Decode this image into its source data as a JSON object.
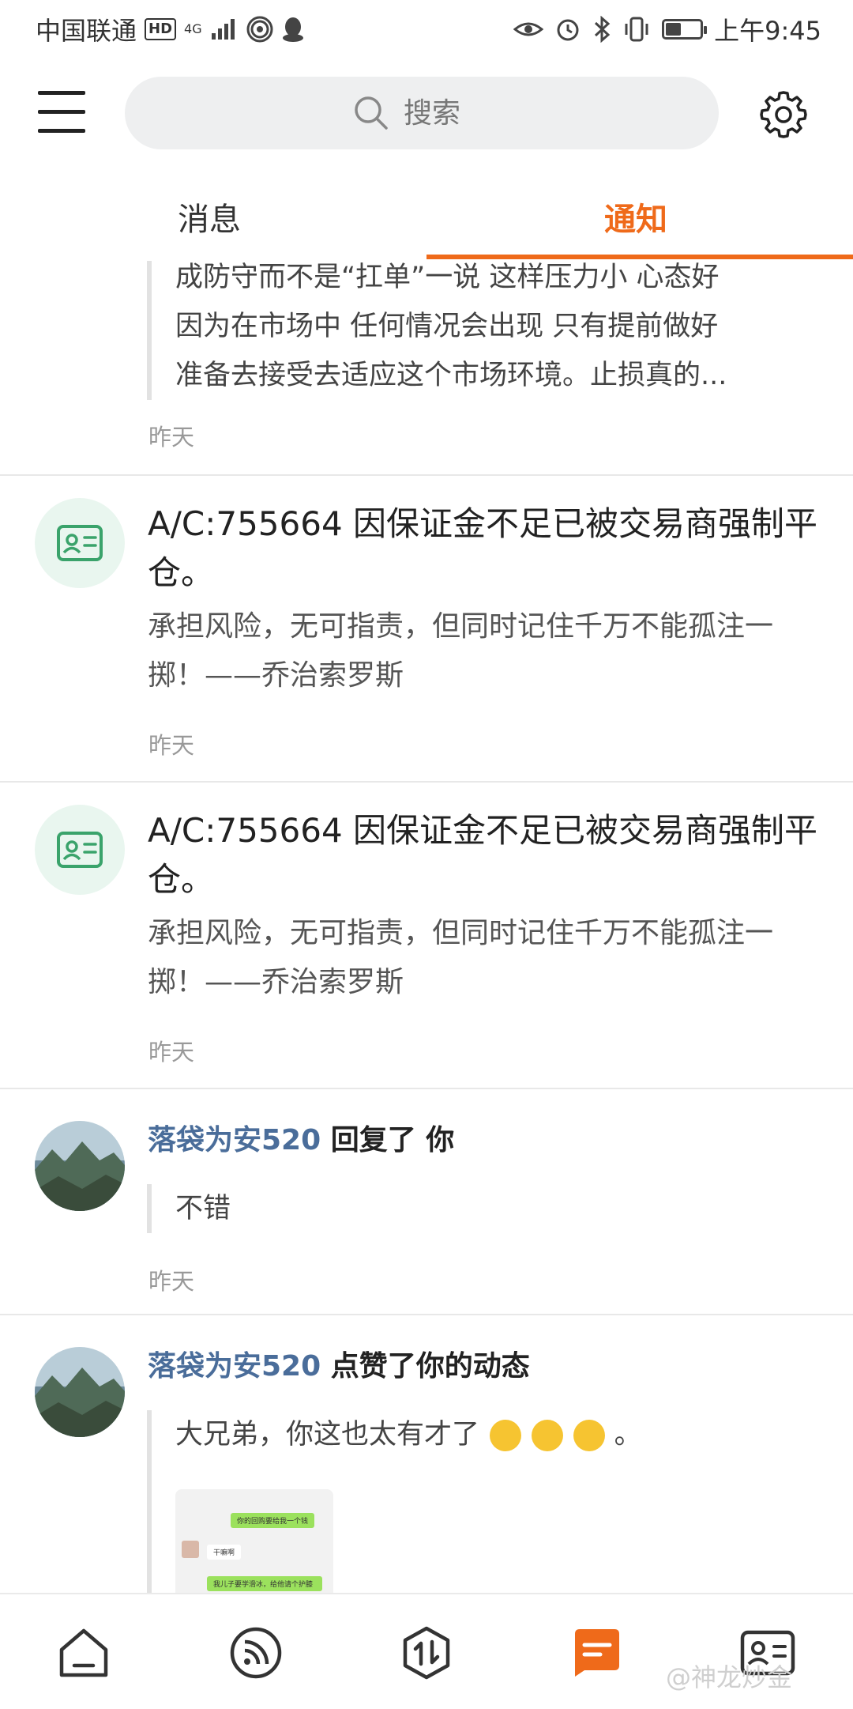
{
  "status_bar": {
    "carrier": "中国联通",
    "hd": "HD",
    "network": "4G",
    "time": "上午9:45",
    "battery_level": 0.45
  },
  "header": {
    "search_placeholder": "搜索"
  },
  "tabs": [
    {
      "label": "消息",
      "active": false
    },
    {
      "label": "通知",
      "active": true
    }
  ],
  "notifications": [
    {
      "lines": [
        "成防守而不是“扛单”一说 这样压力小 心态好",
        "因为在市场中 任何情况会出现 只有提前做好",
        "准备去接受去适应这个市场环境。止损真的..."
      ],
      "time": "昨天"
    },
    {
      "icon": "id-card-icon",
      "title": "A/C:755664  因保证金不足已被交易商强制平仓。",
      "body": "承担风险，无可指责，但同时记住千万不能孤注一掷！——乔治索罗斯",
      "time": "昨天"
    },
    {
      "icon": "id-card-icon",
      "title": "A/C:755664  因保证金不足已被交易商强制平仓。",
      "body": "承担风险，无可指责，但同时记住千万不能孤注一掷！——乔治索罗斯",
      "time": "昨天"
    },
    {
      "user": "落袋为安520",
      "action": "回复了 你",
      "quote": "不错",
      "time": "昨天"
    },
    {
      "user": "落袋为安520",
      "action": "点赞了你的动态",
      "quote": "大兄弟，你这也太有才了",
      "quote_end": "。",
      "thumb_lines": [
        "你的回购要给我一个钱",
        "干嘛啊",
        "我儿子要学滑冰，给他请个护膝"
      ]
    }
  ],
  "bottom_nav": [
    "home-icon",
    "feed-icon",
    "trade-icon",
    "message-icon",
    "profile-icon"
  ],
  "watermark": "@神龙炒金",
  "colors": {
    "accent": "#ef6a1a",
    "username": "#4a6d9a",
    "icon_green": "#3aa36b"
  }
}
